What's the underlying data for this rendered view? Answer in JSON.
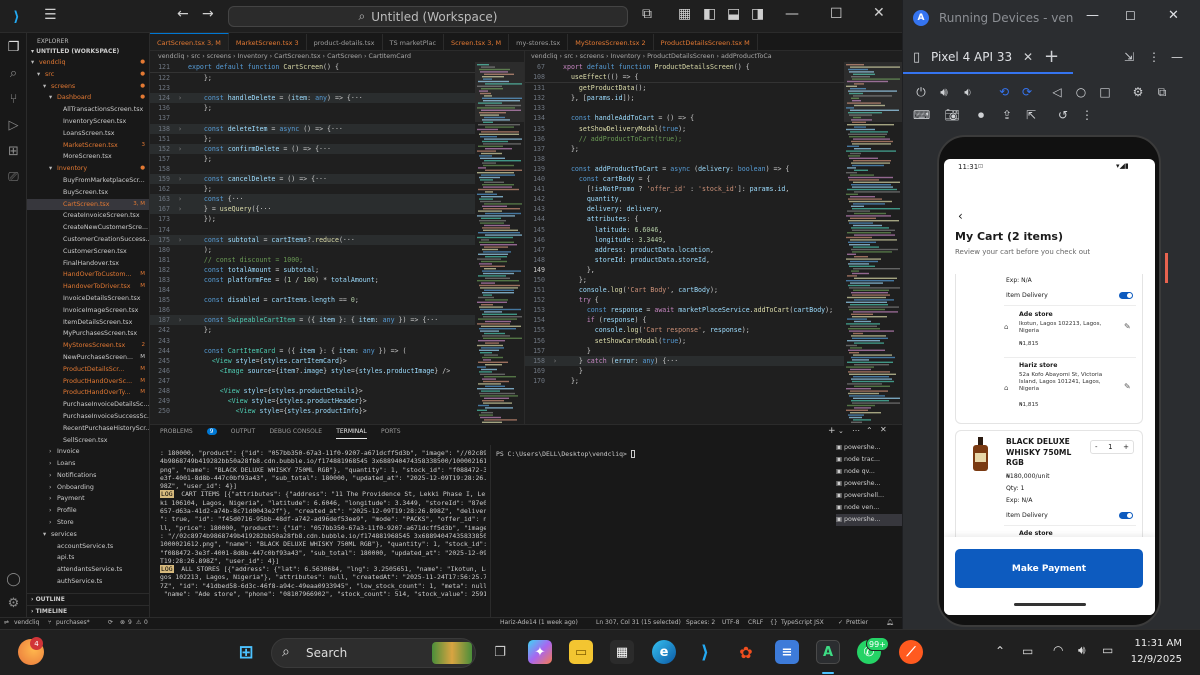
{
  "titlebar": {
    "search": "Untitled (Workspace)"
  },
  "explorer": {
    "header": "EXPLORER",
    "workspace": "UNTITLED (WORKSPACE)",
    "tree": [
      {
        "label": "vendcliq",
        "indent": 0,
        "arrow": "▾",
        "color": "#e37933",
        "dot": true
      },
      {
        "label": "src",
        "indent": 1,
        "arrow": "▾",
        "color": "#e37933",
        "dot": true
      },
      {
        "label": "screens",
        "indent": 2,
        "arrow": "▾",
        "color": "#e37933",
        "dot": true
      },
      {
        "label": "Dashboard",
        "indent": 3,
        "arrow": "▾",
        "color": "#e37933",
        "dot": true
      },
      {
        "label": "AllTransactionsScreen.tsx",
        "indent": 4,
        "color": "#cccccc"
      },
      {
        "label": "InventoryScreen.tsx",
        "indent": 4,
        "color": "#cccccc"
      },
      {
        "label": "LoansScreen.tsx",
        "indent": 4,
        "color": "#cccccc"
      },
      {
        "label": "MarketScreen.tsx",
        "indent": 4,
        "color": "#e37933",
        "badge": "3"
      },
      {
        "label": "MoreScreen.tsx",
        "indent": 4,
        "color": "#cccccc"
      },
      {
        "label": "Inventory",
        "indent": 3,
        "arrow": "▾",
        "color": "#e37933",
        "dot": true
      },
      {
        "label": "BuyFromMarketplaceScr...",
        "indent": 4,
        "color": "#cccccc"
      },
      {
        "label": "BuyScreen.tsx",
        "indent": 4,
        "color": "#cccccc"
      },
      {
        "label": "CartScreen.tsx",
        "indent": 4,
        "color": "#e37933",
        "badge": "3, M",
        "selected": true
      },
      {
        "label": "CreateInvoiceScreen.tsx",
        "indent": 4,
        "color": "#cccccc"
      },
      {
        "label": "CreateNewCustomerScre...",
        "indent": 4,
        "color": "#cccccc"
      },
      {
        "label": "CustomerCreationSuccess...",
        "indent": 4,
        "color": "#cccccc"
      },
      {
        "label": "CustomerScreen.tsx",
        "indent": 4,
        "color": "#cccccc"
      },
      {
        "label": "FinalHandover.tsx",
        "indent": 4,
        "color": "#cccccc"
      },
      {
        "label": "HandOverToCustom...",
        "indent": 4,
        "color": "#e37933",
        "badge": "M"
      },
      {
        "label": "HandoverToDriver.tsx",
        "indent": 4,
        "color": "#e37933",
        "badge": "M"
      },
      {
        "label": "InvoiceDetailsScreen.tsx",
        "indent": 4,
        "color": "#cccccc"
      },
      {
        "label": "InvoiceImageScreen.tsx",
        "indent": 4,
        "color": "#cccccc"
      },
      {
        "label": "ItemDetailsScreen.tsx",
        "indent": 4,
        "color": "#cccccc"
      },
      {
        "label": "MyPurchasesScreen.tsx",
        "indent": 4,
        "color": "#cccccc"
      },
      {
        "label": "MyStoresScreen.tsx",
        "indent": 4,
        "color": "#e37933",
        "badge": "2"
      },
      {
        "label": "NewPurchaseScreen...",
        "indent": 4,
        "color": "#cccccc",
        "badge": "M"
      },
      {
        "label": "ProductDetailsScr...",
        "indent": 4,
        "color": "#e37933",
        "badge": "M"
      },
      {
        "label": "ProductHandOverSc...",
        "indent": 4,
        "color": "#e37933",
        "badge": "M"
      },
      {
        "label": "ProductHandOverTy...",
        "indent": 4,
        "color": "#e37933",
        "badge": "M"
      },
      {
        "label": "PurchaseInvoiceDetailsSc...",
        "indent": 4,
        "color": "#cccccc"
      },
      {
        "label": "PurchaseInvoiceSuccessSc...",
        "indent": 4,
        "color": "#cccccc"
      },
      {
        "label": "RecentPurchaseHistoryScr...",
        "indent": 4,
        "color": "#cccccc"
      },
      {
        "label": "SellScreen.tsx",
        "indent": 4,
        "color": "#cccccc"
      },
      {
        "label": "Invoice",
        "indent": 3,
        "arrow": "›",
        "color": "#cccccc"
      },
      {
        "label": "Loans",
        "indent": 3,
        "arrow": "›",
        "color": "#cccccc"
      },
      {
        "label": "Notifications",
        "indent": 3,
        "arrow": "›",
        "color": "#cccccc"
      },
      {
        "label": "Onboarding",
        "indent": 3,
        "arrow": "›",
        "color": "#cccccc"
      },
      {
        "label": "Payment",
        "indent": 3,
        "arrow": "›",
        "color": "#cccccc"
      },
      {
        "label": "Profile",
        "indent": 3,
        "arrow": "›",
        "color": "#cccccc"
      },
      {
        "label": "Store",
        "indent": 3,
        "arrow": "›",
        "color": "#cccccc"
      },
      {
        "label": "services",
        "indent": 2,
        "arrow": "▾",
        "color": "#cccccc"
      },
      {
        "label": "accountService.ts",
        "indent": 3,
        "color": "#cccccc"
      },
      {
        "label": "api.ts",
        "indent": 3,
        "color": "#cccccc"
      },
      {
        "label": "attendantsService.ts",
        "indent": 3,
        "color": "#cccccc"
      },
      {
        "label": "authService.ts",
        "indent": 3,
        "color": "#cccccc"
      }
    ],
    "outline": "OUTLINE",
    "timeline": "TIMELINE"
  },
  "tabs": [
    {
      "label": "CartScreen.tsx 3, M",
      "active": true,
      "color": "#e37933"
    },
    {
      "label": "MarketScreen.tsx 3",
      "color": "#e37933"
    },
    {
      "label": "product-details.tsx",
      "color": "#9d9d9d"
    },
    {
      "label": "TS marketPlac",
      "color": "#9d9d9d"
    },
    {
      "label": "Screen.tsx 3, M",
      "color": "#e37933"
    },
    {
      "label": "my-stores.tsx",
      "color": "#9d9d9d"
    },
    {
      "label": "MyStoresScreen.tsx 2",
      "color": "#e37933"
    },
    {
      "label": "ProductDetailsScreen.tsx M",
      "color": "#e37933"
    }
  ],
  "left_editor": {
    "crumb": "vendcliq › src › screens › Inventory › CartScreen.tsx › CartScreen › CartItemCard",
    "sticky": "export default function CartScreen() {",
    "lines": [
      {
        "n": "122",
        "t": "    };"
      },
      {
        "n": "123",
        "t": ""
      },
      {
        "n": "124",
        "t": "    const handleDelete = (item: any) => {···",
        "fold": true
      },
      {
        "n": "136",
        "t": "    };"
      },
      {
        "n": "137",
        "t": ""
      },
      {
        "n": "138",
        "t": "    const deleteItem = async () => {···",
        "fold": true
      },
      {
        "n": "151",
        "t": "    };"
      },
      {
        "n": "152",
        "t": "    const confirmDelete = () => {···",
        "fold": true
      },
      {
        "n": "157",
        "t": "    };"
      },
      {
        "n": "158",
        "t": ""
      },
      {
        "n": "159",
        "t": "    const cancelDelete = () => {···",
        "fold": true
      },
      {
        "n": "162",
        "t": "    };"
      },
      {
        "n": "163",
        "t": "    const {···",
        "fold": true
      },
      {
        "n": "167",
        "t": "    } = useQuery({···",
        "fold": true
      },
      {
        "n": "173",
        "t": "    });"
      },
      {
        "n": "174",
        "t": ""
      },
      {
        "n": "175",
        "t": "    const subtotal = cartItems?.reduce(···",
        "fold": true
      },
      {
        "n": "180",
        "t": "    );"
      },
      {
        "n": "181",
        "t": "    // const discount = 1000;"
      },
      {
        "n": "182",
        "t": "    const totalAmount = subtotal;"
      },
      {
        "n": "183",
        "t": "    const platformFee = (1 / 100) * totalAmount;"
      },
      {
        "n": "184",
        "t": ""
      },
      {
        "n": "185",
        "t": "    const disabled = cartItems.length == 0;"
      },
      {
        "n": "186",
        "t": ""
      },
      {
        "n": "187",
        "t": "    const SwipeableCartItem = ({ item }: { item: any }) => {···",
        "fold": true
      },
      {
        "n": "242",
        "t": "    };"
      },
      {
        "n": "243",
        "t": ""
      },
      {
        "n": "244",
        "t": "    const CartItemCard = ({ item }: { item: any }) => ("
      },
      {
        "n": "245",
        "t": "      <View style={styles.cartItemCard}>"
      },
      {
        "n": "246",
        "t": "        <Image source={item?.image} style={styles.productImage} />"
      },
      {
        "n": "247",
        "t": ""
      },
      {
        "n": "248",
        "t": "        <View style={styles.productDetails}>"
      },
      {
        "n": "249",
        "t": "          <View style={styles.productHeader}>"
      },
      {
        "n": "250",
        "t": "            <View style={styles.productInfo}>"
      }
    ]
  },
  "right_editor": {
    "crumb": "vendcliq › src › screens › Inventory › ProductDetailsScreen › addProductToCa",
    "sticky_lines": [
      {
        "n": "67",
        "t": "xport default function ProductDetailsScreen() {"
      },
      {
        "n": "108",
        "t": "  useEffect(() => {"
      }
    ],
    "lines": [
      {
        "n": "131",
        "t": "    getProductData();"
      },
      {
        "n": "132",
        "t": "  }, [params.id]);"
      },
      {
        "n": "133",
        "t": ""
      },
      {
        "n": "134",
        "t": "  const handleAddToCart = () => {"
      },
      {
        "n": "135",
        "t": "    setShowDeliveryModal(true);"
      },
      {
        "n": "136",
        "t": "    // addProductToCart(true);"
      },
      {
        "n": "137",
        "t": "  };"
      },
      {
        "n": "138",
        "t": ""
      },
      {
        "n": "139",
        "t": "  const addProductToCart = async (delivery: boolean) => {"
      },
      {
        "n": "140",
        "t": "    const cartBody = {"
      },
      {
        "n": "141",
        "t": "      [!isNotPromo ? 'offer_id' : 'stock_id']: params.id,"
      },
      {
        "n": "142",
        "t": "      quantity,"
      },
      {
        "n": "143",
        "t": "      delivery: delivery,"
      },
      {
        "n": "144",
        "t": "      attributes: {"
      },
      {
        "n": "145",
        "t": "        latitude: 6.6046,"
      },
      {
        "n": "146",
        "t": "        longitude: 3.3449,"
      },
      {
        "n": "147",
        "t": "        address: productData.location,"
      },
      {
        "n": "148",
        "t": "        storeId: productData.storeId,"
      },
      {
        "n": "149",
        "t": "      },",
        "cur": true
      },
      {
        "n": "150",
        "t": "    };"
      },
      {
        "n": "151",
        "t": "    console.log('Cart Body', cartBody);"
      },
      {
        "n": "152",
        "t": "    try {"
      },
      {
        "n": "153",
        "t": "      const response = await marketPlaceService.addToCart(cartBody);"
      },
      {
        "n": "154",
        "t": "      if (response) {"
      },
      {
        "n": "155",
        "t": "        console.log('Cart response', response);"
      },
      {
        "n": "156",
        "t": "        setShowCartModal(true);"
      },
      {
        "n": "157",
        "t": "      }"
      },
      {
        "n": "158",
        "t": "    } catch (error: any) {···",
        "fold": true
      },
      {
        "n": "169",
        "t": "    }"
      },
      {
        "n": "170",
        "t": "  };"
      }
    ]
  },
  "panel": {
    "tabs": [
      "PROBLEMS",
      "OUTPUT",
      "DEBUG CONSOLE",
      "TERMINAL",
      "PORTS"
    ],
    "problems_count": "9",
    "terminal_left": [
      ": 180000, \"product\": {\"id\": \"057bb350-67a3-11f0-9207-a671dcff5d3b\", \"image\": \"//02c897",
      "4b9868749b419282bb50a28fb8.cdn.bubble.io/f174881968545 3x688940474358338500/1000021612.",
      "png\", \"name\": \"BLACK DELUXE WHISKY 750ML RGB\"}, \"quantity\": 1, \"stock_id\": \"f088472-3",
      "e3f-4001-8d8b-447c0bf93a43\", \"sub_total\": 180000, \"updated_at\": \"2025-12-09T19:28:26.8",
      "98Z\", \"user_id\": 4}]",
      "LOG  CART ITEMS [{\"attributes\": {\"address\": \"11 The Providence St, Lekki Phase I, Lek",
      "ki 106104, Lagos, Nigeria\", \"latitude\": 6.6046, \"longitude\": 3.3449, \"storeId\": \"87e0f",
      "657-d63a-41d2-a74b-8c71d0043e2f\"}, \"created_at\": \"2025-12-09T19:28:26.898Z\", \"delivery",
      "\": true, \"id\": \"f45d0716-95bb-48df-a742-ad96def53ee9\", \"mode\": \"PACKS\", \"offer_id\": nu",
      "ll, \"price\": 180000, \"product\": {\"id\": \"057bb350-67a3-11f0-9207-a671dcff5d3b\", \"image\"",
      ": \"//02c8974b9868749b419282bb50a28fb8.cdn.bubble.io/f174881968545 3x688940474358338500/",
      "1000021612.png\", \"name\": \"BLACK DELUXE WHISKY 750ML RGB\"}, \"quantity\": 1, \"stock_id\":",
      "\"f088472-3e3f-4001-8d8b-447c0bf93a43\", \"sub_total\": 180000, \"updated_at\": \"2025-12-09",
      "T19:28:26.898Z\", \"user_id\": 4}]",
      "LOG  ALL STORES [{\"address\": {\"lat\": 6.5630684, \"lng\": 3.2505651, \"name\": \"Ikotun, La",
      "gos 102213, Lagos, Nigeria\"}, \"attributes\": null, \"createdAt\": \"2025-11-24T17:56:25.79",
      "7Z\", \"id\": \"41dbed58-6d3c-46f8-a94c-49eaa0933945\", \"low_stock_count\": 1, \"meta\": null,",
      " \"name\": \"Ade store\", \"phone\": \"08107966902\", \"stock_count\": 514, \"stock_value\": 25910"
    ],
    "terminal_right": "PS C:\\Users\\DELL\\Desktop\\vendcliq> ",
    "terminals": [
      "powershe...",
      "node trac...",
      "node qv...",
      "powershe...",
      "powershell...",
      "node ven...",
      "powershe..."
    ]
  },
  "status": {
    "branch": "purchases*",
    "errors": "9",
    "warnings": "0",
    "author": "Hariz-Ade14 (1 week ago)",
    "position": "Ln 307, Col 31 (15 selected)",
    "spaces": "Spaces: 2",
    "encoding": "UTF-8",
    "eol": "CRLF",
    "language": "TypeScript JSX",
    "formatter": "Prettier",
    "repo": "vendcliq"
  },
  "running_devices": {
    "title": "Running Devices - ven",
    "device_tab": "Pixel 4 API 33"
  },
  "phone": {
    "time": "11:31",
    "title": "My Cart (2 items)",
    "subtitle": "Review your cart before you check out",
    "item1": {
      "exp": "Exp: N/A",
      "delivery_label": "Item Delivery",
      "stores": [
        {
          "name": "Ade store",
          "address": "Ikotun, Lagos 102213, Lagos, Nigeria",
          "price": "₦1,815"
        },
        {
          "name": "Hariz store",
          "address": "52a Kofo Abayomi St, Victoria Island, Lagos 101241, Lagos, Nigeria",
          "price": "₦1,815"
        }
      ]
    },
    "item2": {
      "name": "BLACK DELUXE WHISKY 750ML RGB",
      "unit_price": "₦180,000/unit",
      "qty": "Qty: 1",
      "exp": "Exp: N/A",
      "delivery_label": "Item Delivery",
      "quantity": "1",
      "next_store": "Ade store"
    },
    "pay_button": "Make Payment"
  },
  "taskbar": {
    "search": "Search",
    "time": "11:31 AM",
    "date": "12/9/2025",
    "weather_badge": "4",
    "whatsapp_badge": "99+"
  }
}
